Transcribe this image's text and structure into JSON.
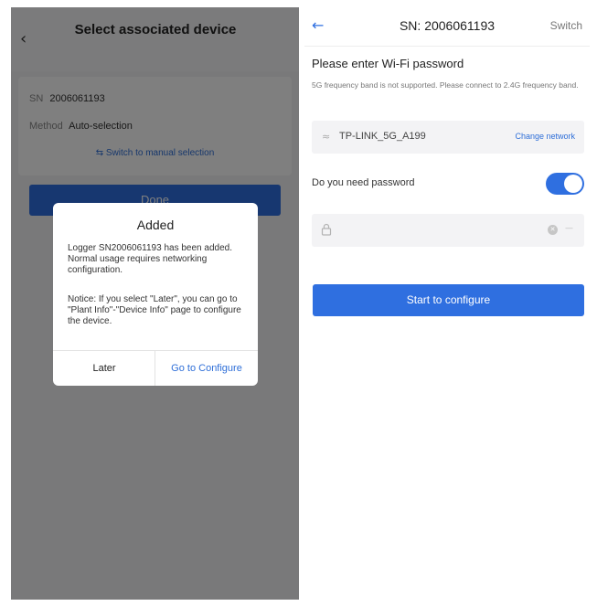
{
  "left": {
    "header": {
      "back_icon": "chevron-left-icon",
      "title": "Select associated device"
    },
    "info": {
      "sn_label": "SN",
      "sn_value": "2006061193",
      "method_label": "Method",
      "method_value": "Auto-selection",
      "switch_link": "Switch to manual selection"
    },
    "done_label": "Done",
    "dialog": {
      "title": "Added",
      "message": "Logger SN2006061193 has been added. Normal usage requires networking configuration.",
      "notice": "Notice: If you select \"Later\", you can go to \"Plant Info\"-\"Device Info\" page to configure the device.",
      "later": "Later",
      "go_configure": "Go to Configure"
    }
  },
  "right": {
    "header": {
      "back_icon": "arrow-left-icon",
      "title": "SN: 2006061193",
      "switch": "Switch"
    },
    "prompt": "Please enter Wi-Fi password",
    "note": "5G frequency band is not supported. Please connect to 2.4G frequency band.",
    "network": {
      "icon": "wifi-icon",
      "name": "TP-LINK_5G_A199",
      "change": "Change network"
    },
    "need_password_label": "Do you need password",
    "need_password_on": true,
    "password": {
      "value": "",
      "placeholder": ""
    },
    "start_button": "Start to configure"
  },
  "colors": {
    "accent": "#2f6fe0",
    "link": "#2f6fd8",
    "overlay": "rgba(0,0,0,0.5)"
  }
}
